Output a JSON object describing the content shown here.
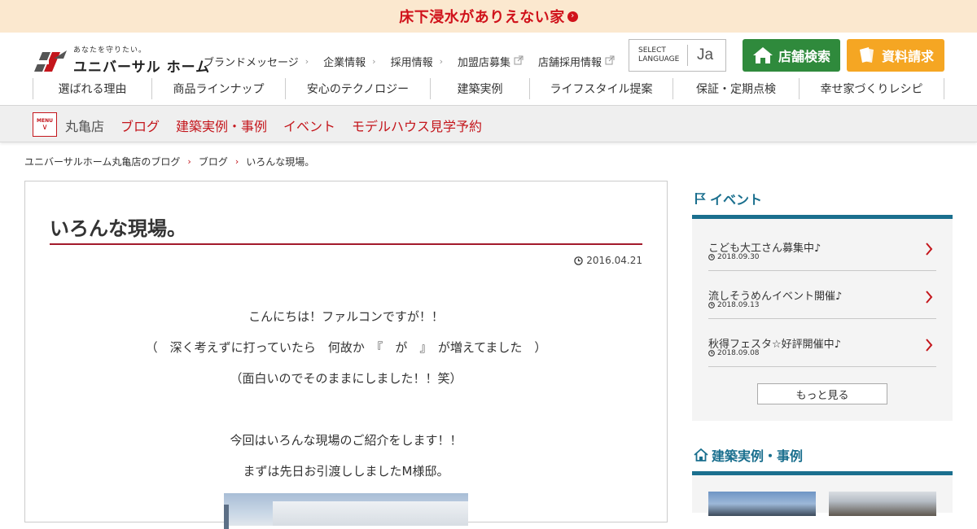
{
  "promo": {
    "text": "床下浸水がありえない家",
    "arrow_icon": "circle-chevron-right-icon"
  },
  "header": {
    "logo": {
      "tagline": "あなたを守りたい。",
      "name": "ユニバーサル ホーム"
    },
    "util_nav": [
      {
        "label": "ブランドメッセージ",
        "icon": "chevron-right-icon"
      },
      {
        "label": "企業情報",
        "icon": "chevron-right-icon"
      },
      {
        "label": "採用情報",
        "icon": "chevron-right-icon"
      },
      {
        "label": "加盟店募集",
        "icon": "external-link-icon"
      },
      {
        "label": "店舗採用情報",
        "icon": "external-link-icon"
      }
    ],
    "language": {
      "label_line1": "SELECT",
      "label_line2": "LANGUAGE",
      "current": "Ja"
    },
    "store_search_label": "店舗検索",
    "document_request_label": "資料請求",
    "main_nav": [
      "選ばれる理由",
      "商品ラインナップ",
      "安心のテクノロジー",
      "建築実例",
      "ライフスタイル提案",
      "保証・定期点検",
      "幸せ家づくりレシピ"
    ]
  },
  "subnav": {
    "menu_label": "MENU",
    "store_name": "丸亀店",
    "links": [
      "ブログ",
      "建築実例・事例",
      "イベント",
      "モデルハウス見学予約"
    ]
  },
  "breadcrumb": [
    "ユニバーサルホーム丸亀店のブログ",
    "ブログ",
    "いろんな現場。"
  ],
  "article": {
    "title": "いろんな現場。",
    "date": "2016.04.21",
    "paragraphs": [
      "こんにちは！ファルコンですが！！",
      "（　深く考えずに打っていたら　何故か　『　が　』　が増えてました　）",
      "（面白いのでそのままにしました！！笑）",
      "",
      "今回はいろんな現場のご紹介をします！！",
      "まずは先日お引渡ししましたM様邸。"
    ]
  },
  "sidebar": {
    "events": {
      "heading": "イベント",
      "items": [
        {
          "title": "こども大工さん募集中♪",
          "date": "2018.09.30"
        },
        {
          "title": "流しそうめんイベント開催♪",
          "date": "2018.09.13"
        },
        {
          "title": "秋得フェスタ☆好評開催中♪",
          "date": "2018.09.08"
        }
      ],
      "more_label": "もっと見る"
    },
    "cases": {
      "heading": "建築実例・事例"
    }
  },
  "colors": {
    "brand_red": "#c4161c",
    "accent_teal": "#1a6f8e",
    "store_green": "#2f8a3c",
    "doc_orange": "#f5a623",
    "promo_bg": "#fbe8cf"
  }
}
